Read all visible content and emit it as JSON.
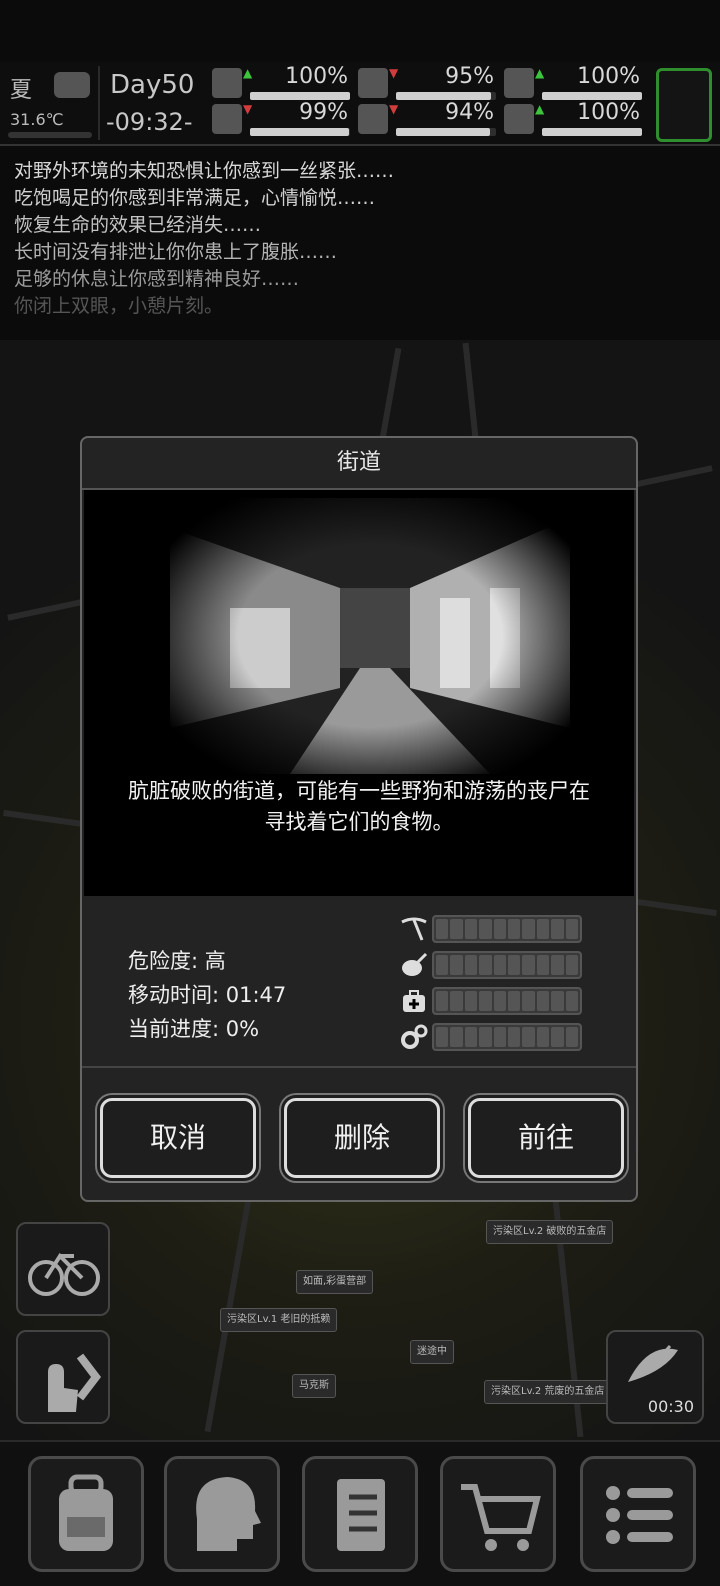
{
  "status": {
    "season": "夏",
    "temperature": "31.6℃",
    "day": "Day50",
    "time": "-09:32-",
    "stats": [
      {
        "name": "health",
        "value": "100%",
        "fraction": 1.0,
        "trend": "up",
        "trend_color": "#3cc43c"
      },
      {
        "name": "food",
        "value": "95%",
        "fraction": 0.95,
        "trend": "down",
        "trend_color": "#d23c3c"
      },
      {
        "name": "mood",
        "value": "100%",
        "fraction": 1.0,
        "trend": "up",
        "trend_color": "#3cc43c"
      },
      {
        "name": "stamina",
        "value": "99%",
        "fraction": 0.99,
        "trend": "down",
        "trend_color": "#d23c3c"
      },
      {
        "name": "water",
        "value": "94%",
        "fraction": 0.94,
        "trend": "down",
        "trend_color": "#d23c3c"
      },
      {
        "name": "heart",
        "value": "100%",
        "fraction": 1.0,
        "trend": "up",
        "trend_color": "#3cc43c"
      }
    ]
  },
  "log": [
    "对野外环境的未知恐惧让你感到一丝紧张……",
    "吃饱喝足的你感到非常满足，心情愉悦……",
    "恢复生命的效果已经消失……",
    "长时间没有排泄让你你患上了腹胀……",
    "足够的休息让你感到精神良好……",
    "你闭上双眼，小憩片刻。"
  ],
  "dialog": {
    "title": "街道",
    "description_line1": "肮脏破败的街道，可能有一些野狗和游荡的丧尸在",
    "description_line2": "寻找着它们的食物。",
    "danger_label": "危险度: 高",
    "travel_label": "移动时间: 01:47",
    "progress_label": "当前进度: 0%",
    "resource_icons": [
      "pickaxe-icon",
      "meat-icon",
      "medkit-icon",
      "gears-icon"
    ],
    "cancel_label": "取消",
    "delete_label": "删除",
    "go_label": "前往"
  },
  "map_pins": [
    "如面,彩蛋营部",
    "污染区Lv.1 老旧的抵赖",
    "污染区Lv.2 破败的五金店",
    "污染区Lv.2 荒废的五金店",
    "迷途中",
    "马克斯"
  ],
  "radar_time": "00:30",
  "colors": {
    "accent_green": "#2f8f2f"
  }
}
